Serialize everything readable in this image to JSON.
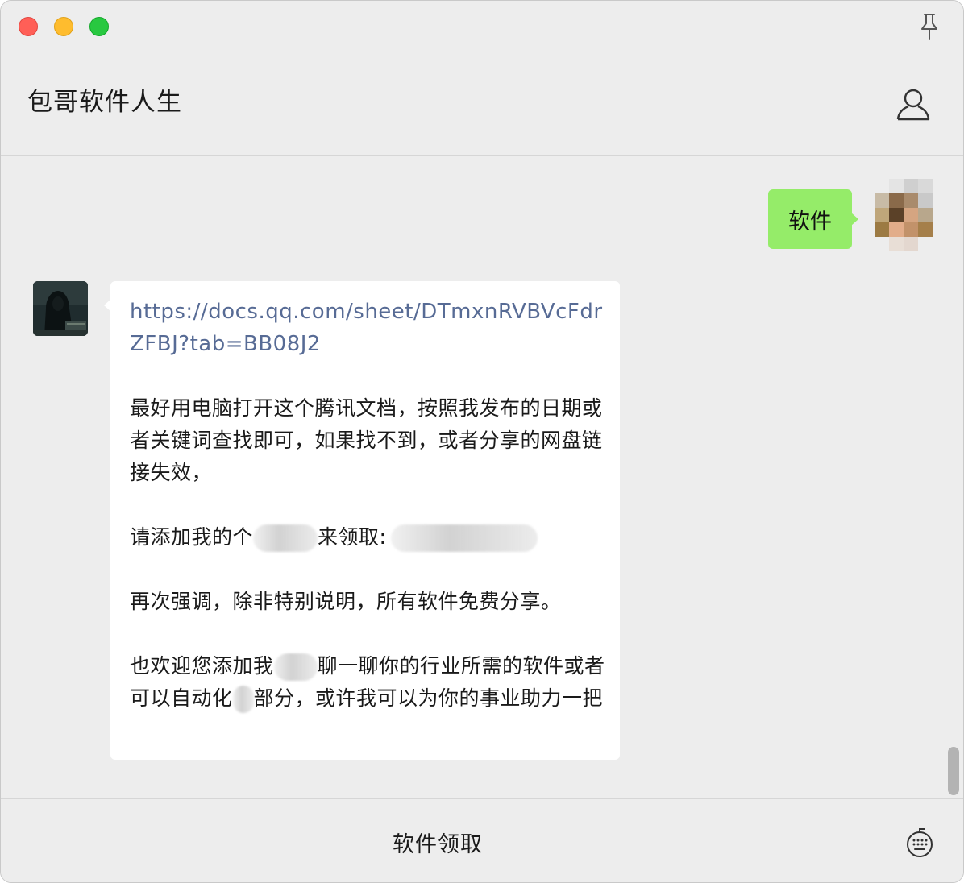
{
  "window": {
    "title": "包哥软件人生"
  },
  "titlebar": {
    "pin_icon": "pin-icon",
    "profile_icon": "user-profile-icon"
  },
  "messages": {
    "outgoing": {
      "text": "软件"
    },
    "incoming": {
      "link": "https://docs.qq.com/sheet/DTmxnRVBVcFdrZFBJ?tab=BB08J2",
      "para1": "最好用电脑打开这个腾讯文档，按照我发布的日期或者关键词查找即可，如果找不到，或者分享的网盘链接失效，",
      "para2_prefix": "请添加我的个",
      "para2_middle": "来领取:",
      "para3": "再次强调，除非特别说明，所有软件免费分享。",
      "para4_prefix": "也欢迎您添加我",
      "para4_middle": "聊一聊你的行业所需的软件或者可以自动化",
      "para4_suffix": "部分，或许我可以为你的事业助力一把"
    }
  },
  "bottom": {
    "menu_label": "软件领取",
    "keyboard_icon": "keyboard-icon"
  },
  "colors": {
    "outgoing_bubble": "#95ec69",
    "incoming_bubble": "#ffffff",
    "link": "#576b95",
    "background": "#ededed"
  }
}
